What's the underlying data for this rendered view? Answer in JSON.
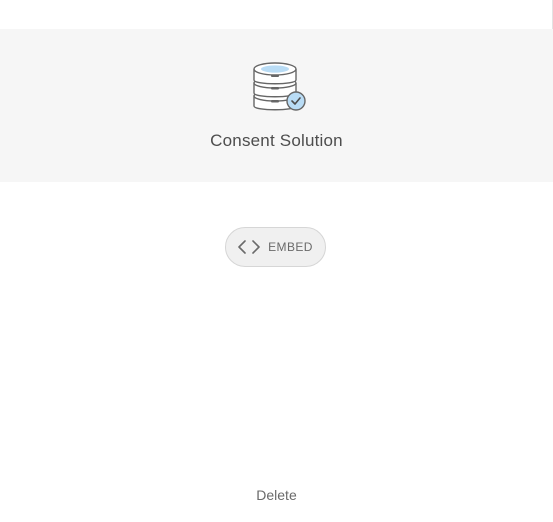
{
  "card": {
    "title": "Consent Solution",
    "icon": "database-check-icon"
  },
  "actions": {
    "embed_label": "EMBED",
    "embed_icon": "code-brackets-icon",
    "delete_label": "Delete"
  },
  "colors": {
    "header_background": "#f6f6f6",
    "icon_accent": "#b9dcf5",
    "text": "#4d4d4d"
  }
}
